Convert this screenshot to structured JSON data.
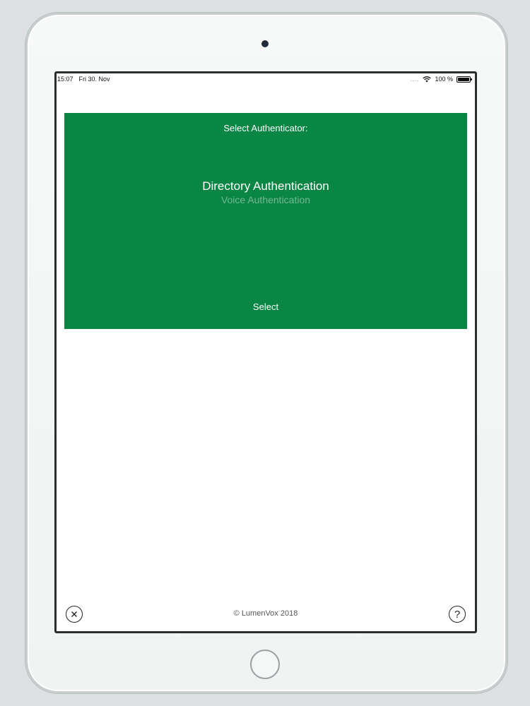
{
  "status_bar": {
    "time": "15:07",
    "date": "Fri 30. Nov",
    "signal": "....",
    "battery": "100 %",
    "battery_level": 1.0
  },
  "authenticator_panel": {
    "title": "Select Authenticator:",
    "options": [
      "Directory Authentication",
      "Voice Authentication",
      ""
    ],
    "selected_option": "Directory Authentication",
    "select_label": "Select",
    "background_color": "#0a8644"
  },
  "footer": {
    "copyright": "© LumenVox 2018",
    "close_icon": "close-circle-icon",
    "help_icon": "help-circle-icon",
    "help_glyph": "?"
  }
}
